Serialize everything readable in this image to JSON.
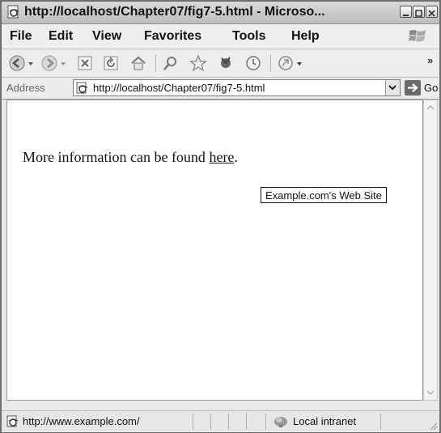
{
  "window": {
    "title": "http://localhost/Chapter07/fig7-5.html - Microso..."
  },
  "menu": {
    "items": [
      "File",
      "Edit",
      "View",
      "Favorites",
      "Tools",
      "Help"
    ]
  },
  "toolbar": {
    "icons": [
      "back-icon",
      "forward-icon",
      "stop-icon",
      "refresh-icon",
      "home-icon",
      "search-icon",
      "favorites-icon",
      "media-icon",
      "history-icon",
      "mail-icon"
    ],
    "overflow": "»"
  },
  "address": {
    "label": "Address",
    "url": "http://localhost/Chapter07/fig7-5.html",
    "go_label": "Go"
  },
  "page": {
    "text_before": "More information can be found ",
    "link_text": "here",
    "text_after": ".",
    "tooltip": "Example.com's Web Site"
  },
  "status": {
    "text": "http://www.example.com/",
    "zone": "Local intranet"
  }
}
